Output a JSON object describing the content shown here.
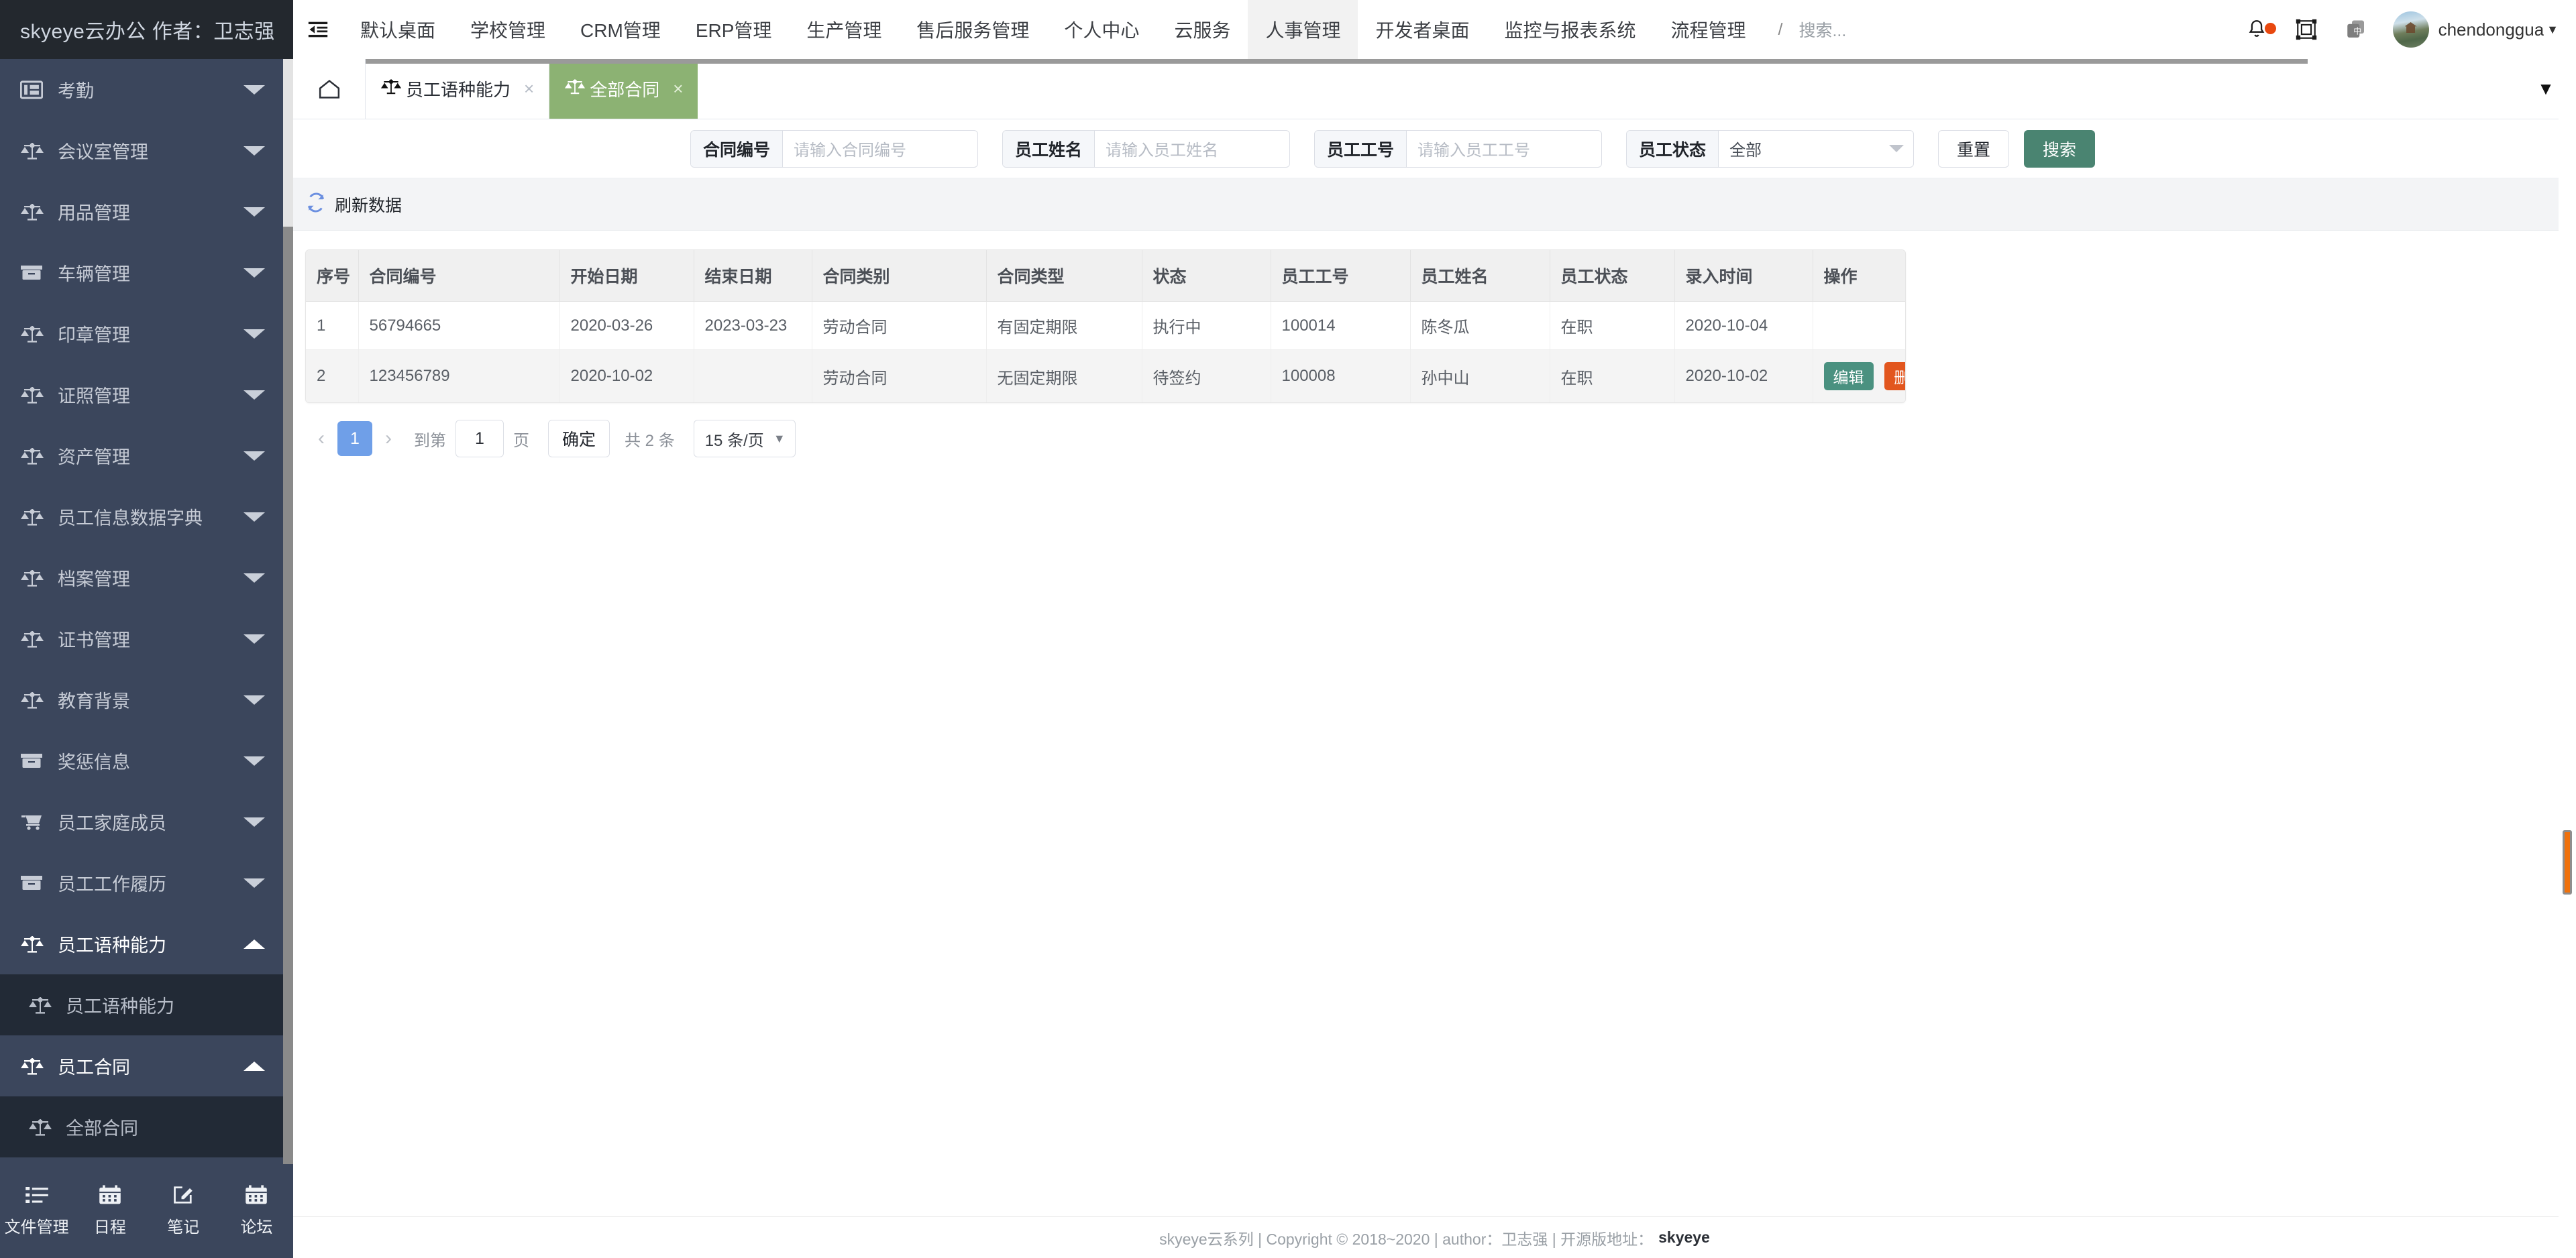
{
  "brand": {
    "title": "skyeye云办公 作者：卫志强"
  },
  "topnav": {
    "collapse_icon": "menu-fold-icon",
    "items": [
      {
        "label": "默认桌面",
        "active": false
      },
      {
        "label": "学校管理",
        "active": false
      },
      {
        "label": "CRM管理",
        "active": false
      },
      {
        "label": "ERP管理",
        "active": false
      },
      {
        "label": "生产管理",
        "active": false
      },
      {
        "label": "售后服务管理",
        "active": false
      },
      {
        "label": "个人中心",
        "active": false
      },
      {
        "label": "云服务",
        "active": false
      },
      {
        "label": "人事管理",
        "active": true
      },
      {
        "label": "开发者桌面",
        "active": false
      },
      {
        "label": "监控与报表系统",
        "active": false
      },
      {
        "label": "流程管理",
        "active": false
      }
    ],
    "separator": "/",
    "search_placeholder": "搜索...",
    "bell_icon": "bell-icon",
    "fullscreen_icon": "fullscreen-icon",
    "lang_icon": "language-中-icon",
    "username": "chendonggua",
    "user_caret": "▼"
  },
  "sidebar": {
    "items": [
      {
        "label": "考勤",
        "icon": "attendance-icon",
        "state": "collapsed",
        "level": "top"
      },
      {
        "label": "会议室管理",
        "icon": "scale-icon",
        "state": "collapsed",
        "level": "top"
      },
      {
        "label": "用品管理",
        "icon": "scale-icon",
        "state": "collapsed",
        "level": "top"
      },
      {
        "label": "车辆管理",
        "icon": "box-icon",
        "state": "collapsed",
        "level": "top"
      },
      {
        "label": "印章管理",
        "icon": "scale-icon",
        "state": "collapsed",
        "level": "top"
      },
      {
        "label": "证照管理",
        "icon": "scale-icon",
        "state": "collapsed",
        "level": "top"
      },
      {
        "label": "资产管理",
        "icon": "scale-icon",
        "state": "collapsed",
        "level": "top"
      },
      {
        "label": "员工信息数据字典",
        "icon": "scale-icon",
        "state": "collapsed",
        "level": "top"
      },
      {
        "label": "档案管理",
        "icon": "scale-icon",
        "state": "collapsed",
        "level": "top"
      },
      {
        "label": "证书管理",
        "icon": "scale-icon",
        "state": "collapsed",
        "level": "top"
      },
      {
        "label": "教育背景",
        "icon": "scale-icon",
        "state": "collapsed",
        "level": "top"
      },
      {
        "label": "奖惩信息",
        "icon": "box-icon",
        "state": "collapsed",
        "level": "top"
      },
      {
        "label": "员工家庭成员",
        "icon": "cart-icon",
        "state": "collapsed",
        "level": "top"
      },
      {
        "label": "员工工作履历",
        "icon": "box-icon",
        "state": "collapsed",
        "level": "top"
      },
      {
        "label": "员工语种能力",
        "icon": "scale-icon",
        "state": "expanded",
        "level": "top"
      },
      {
        "label": "员工语种能力",
        "icon": "scale-icon",
        "state": "none",
        "level": "sub"
      },
      {
        "label": "员工合同",
        "icon": "scale-icon",
        "state": "expanded",
        "level": "top"
      },
      {
        "label": "全部合同",
        "icon": "scale-icon",
        "state": "none",
        "level": "sub"
      }
    ],
    "footer_items": [
      {
        "label": "文件管理",
        "icon": "list-icon"
      },
      {
        "label": "日程",
        "icon": "calendar-icon"
      },
      {
        "label": "笔记",
        "icon": "note-edit-icon"
      },
      {
        "label": "论坛",
        "icon": "calendar-icon"
      }
    ]
  },
  "tabbar": {
    "home_icon": "home-icon",
    "tabs": [
      {
        "label": "员工语种能力",
        "icon": "scale-icon",
        "active": false,
        "close": "×"
      },
      {
        "label": "全部合同",
        "icon": "scale-icon",
        "active": true,
        "close": "×"
      }
    ],
    "overflow_caret": "▼"
  },
  "filters": {
    "fields": [
      {
        "label": "合同编号",
        "placeholder": "请输入合同编号",
        "value": "",
        "type": "text"
      },
      {
        "label": "员工姓名",
        "placeholder": "请输入员工姓名",
        "value": "",
        "type": "text"
      },
      {
        "label": "员工工号",
        "placeholder": "请输入员工工号",
        "value": "",
        "type": "text"
      },
      {
        "label": "员工状态",
        "value": "全部",
        "type": "select"
      }
    ],
    "reset_label": "重置",
    "search_label": "搜索"
  },
  "toolbar": {
    "refresh_label": "刷新数据",
    "refresh_icon": "refresh-icon"
  },
  "table": {
    "columns": [
      "序号",
      "合同编号",
      "开始日期",
      "结束日期",
      "合同类别",
      "合同类型",
      "状态",
      "员工工号",
      "员工姓名",
      "员工状态",
      "录入时间",
      "操作"
    ],
    "rows": [
      {
        "cells": [
          "1",
          "56794665",
          "2020-03-26",
          "2023-03-23",
          "劳动合同",
          "有固定期限",
          "执行中",
          "100014",
          "陈冬瓜",
          "在职",
          "2020-10-04"
        ],
        "actions": []
      },
      {
        "cells": [
          "2",
          "123456789",
          "2020-10-02",
          "",
          "劳动合同",
          "无固定期限",
          "待签约",
          "100008",
          "孙中山",
          "在职",
          "2020-10-02"
        ],
        "actions": [
          {
            "label": "编辑",
            "style": "edit"
          },
          {
            "label": "删除",
            "style": "del"
          }
        ]
      }
    ]
  },
  "pagination": {
    "prev": "‹",
    "next": "›",
    "current_page": "1",
    "goto_prefix": "到第",
    "goto_value": "1",
    "goto_suffix": "页",
    "confirm_label": "确定",
    "total_label": "共 2 条",
    "page_size": "15 条/页",
    "page_size_caret": "▼"
  },
  "footer": {
    "text": "skyeye云系列 | Copyright © 2018~2020 | author：卫志强 | 开源版地址：",
    "link": "skyeye"
  },
  "colors": {
    "brand_dark": "#23282e",
    "sidebar": "#3b465c",
    "sidebar_sub": "#222a36",
    "tab_active": "#8cb273",
    "search_button": "#4a8471",
    "edit_button": "#4a9180",
    "delete_button": "#e2561e",
    "page_active": "#6f9fe8",
    "scroll_thumb": "#f0710c",
    "notify_dot": "#e8480f"
  }
}
